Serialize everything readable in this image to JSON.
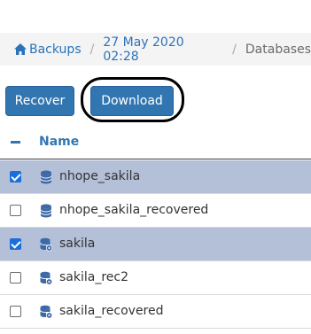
{
  "breadcrumb": {
    "home_label": "Backups",
    "date": "27 May 2020 02:28",
    "current": "Databases",
    "separator": "/"
  },
  "toolbar": {
    "recover_label": "Recover",
    "download_label": "Download"
  },
  "table": {
    "name_header": "Name",
    "rows": [
      {
        "name": "nhope_sakila",
        "checked": true,
        "icon": "database-icon"
      },
      {
        "name": "nhope_sakila_recovered",
        "checked": false,
        "icon": "database-icon"
      },
      {
        "name": "sakila",
        "checked": true,
        "icon": "database-settings-icon"
      },
      {
        "name": "sakila_rec2",
        "checked": false,
        "icon": "database-settings-icon"
      },
      {
        "name": "sakila_recovered",
        "checked": false,
        "icon": "database-settings-icon"
      }
    ]
  },
  "colors": {
    "accent": "#3276b1",
    "selected_row": "#b4bfd8",
    "checkbox_checked": "#1a6fdc"
  }
}
